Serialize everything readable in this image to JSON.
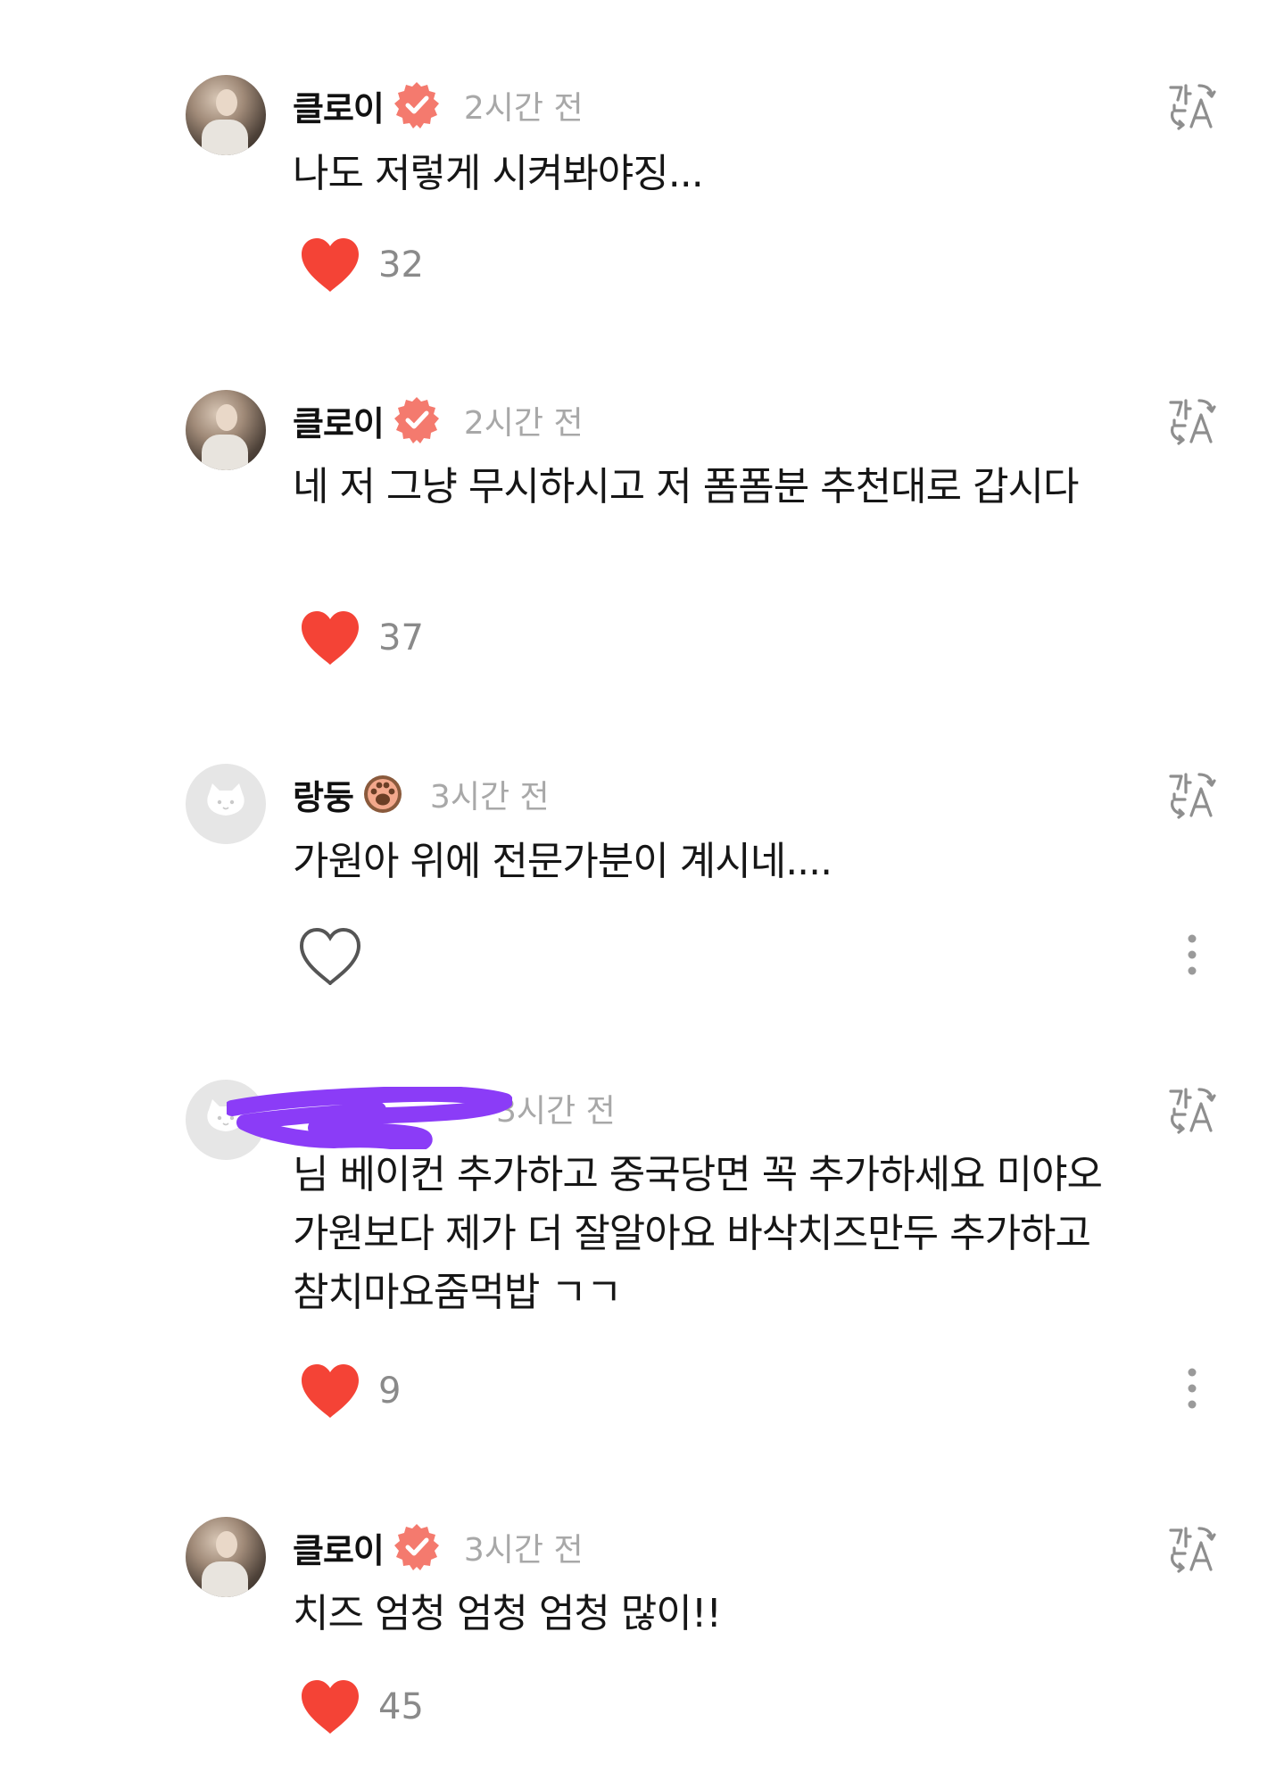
{
  "comments": [
    {
      "username": "클로이",
      "verified": true,
      "time": "2시간 전",
      "text": "나도 저렇게 시켜봐야징...",
      "liked": true,
      "likes": "32",
      "icon": "translate-icon"
    },
    {
      "username": "클로이",
      "verified": true,
      "time": "2시간 전",
      "text": "네 저 그냥 무시하시고 저 폼폼분 추천대로 갑시다",
      "liked": true,
      "likes": "37",
      "icon": "translate-icon"
    },
    {
      "username": "랑둥",
      "badge": "paw-icon",
      "time": "3시간 전",
      "text": "가원아 위에 전문가분이 계시네....",
      "liked": false,
      "likes": "",
      "icon": "translate-icon"
    },
    {
      "username": "",
      "username_redacted": true,
      "time": "3시간 전",
      "text": "님 베이컨 추가하고 중국당면 꼭 추가하세요 미야오 가원보다 제가 더 잘알아요 바삭치즈만두 추가하고 참치마요줌먹밥 ㄱㄱ",
      "liked": true,
      "likes": "9",
      "icon": "translate-icon"
    },
    {
      "username": "클로이",
      "verified": true,
      "time": "3시간 전",
      "text": "치즈 엄청 엄청 엄청 많이!!",
      "liked": true,
      "likes": "45",
      "icon": "translate-icon"
    }
  ],
  "colors": {
    "heart": "#fe2c55",
    "heart_fill": "#f44336",
    "verified": "#f47a6e",
    "redaction": "#8b3cf7",
    "muted_text": "#a8a8a8"
  }
}
